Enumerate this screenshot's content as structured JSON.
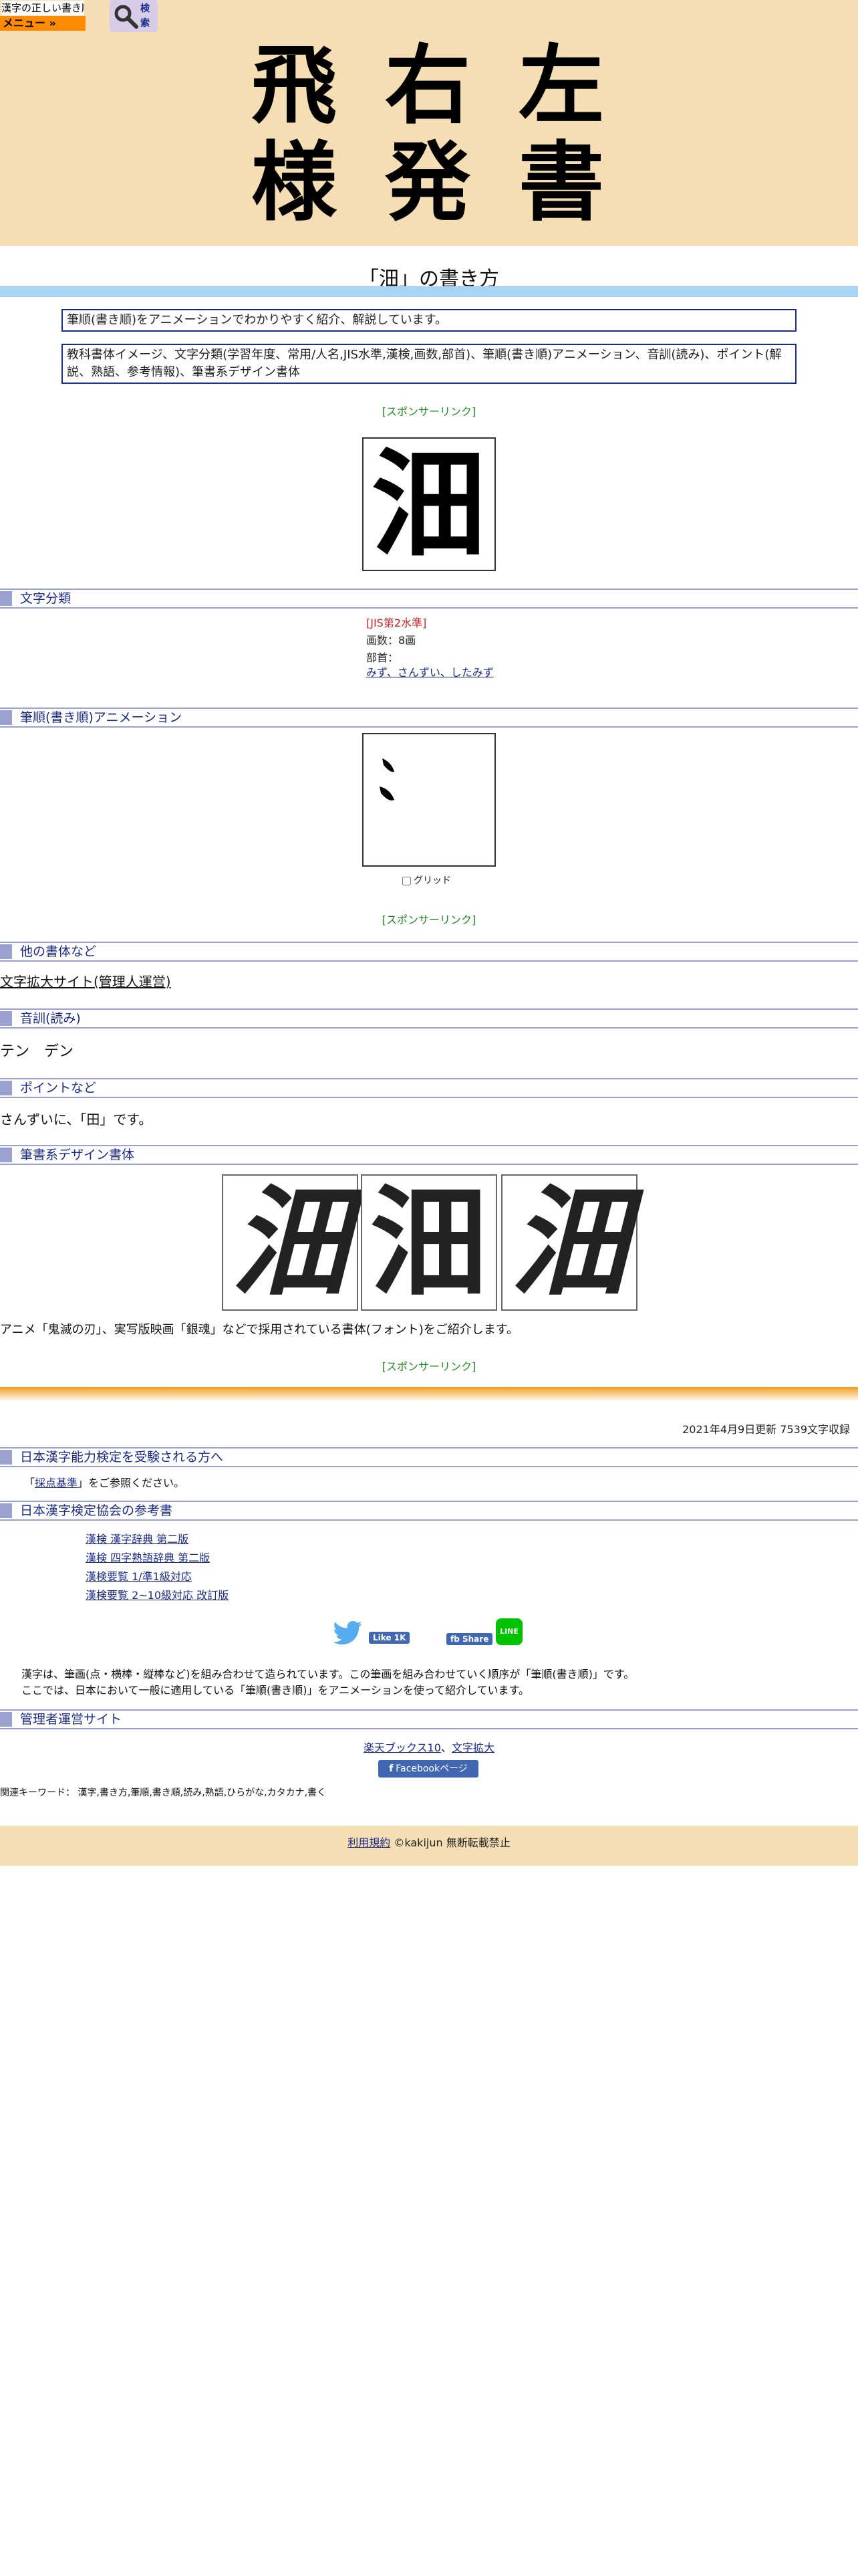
{
  "header": {
    "logo_small": "漢字の正しい書き順(筆順)",
    "menu_label": "メニュー »",
    "search_label": "検索",
    "big_logo_chars": [
      "飛",
      "右",
      "左",
      "様",
      "発",
      "書"
    ]
  },
  "title": "「沺」の書き方",
  "notices": [
    "筆順(書き順)をアニメーションでわかりやすく紹介、解説しています。",
    "教科書体イメージ、文字分類(学習年度、常用/人名,JIS水準,漢検,画数,部首)、筆順(書き順)アニメーション、音訓(読み)、ポイント(解説、熟語、参考情報)、筆書系デザイン書体"
  ],
  "sponsor": "[スポンサーリンク]",
  "kanji": "沺",
  "sections": {
    "classification": "文字分類",
    "animation": "筆順(書き順)アニメーション",
    "other_fonts": "他の書体など",
    "reading": "音訓(読み)",
    "points": "ポイントなど",
    "design": "筆書系デザイン書体",
    "kanken": "日本漢字能力検定を受験される方へ",
    "kanken_refs": "日本漢字検定協会の参考書",
    "admin": "管理者運営サイト"
  },
  "classification": {
    "jis": "[JIS第2水準]",
    "strokes": "画数：8画",
    "radical_label": "部首：",
    "radical_value": "みず、さんずい、したみず"
  },
  "grid_label": "グリッド",
  "other_fonts_link": "文字拡大サイト(管理人運営)",
  "reading_text": "テン　デン",
  "points_text": "さんずいに、「田」です。",
  "design_note": "アニメ「鬼滅の刃」、実写版映画「銀魂」などで採用されている書体(フォント)をご紹介します。",
  "update_text": "2021年4月9日更新 7539文字収録",
  "kanken_text_prefix": "「",
  "kanken_link": "採点基準",
  "kanken_text_suffix": "」をご参照ください。",
  "refs": [
    "漢検 漢字辞典 第二版",
    "漢検 四字熟語辞典 第二版",
    "漢検要覧 1/準1級対応",
    "漢検要覧 2~10級対応 改訂版"
  ],
  "social": {
    "like": "Like 1K",
    "share": "fb Share",
    "line": "LINE"
  },
  "about_lines": [
    "漢字は、筆画(点・横棒・縦棒など)を組み合わせて造られています。この筆画を組み合わせていく順序が「筆順(書き順)」です。",
    "ここでは、日本において一般に適用している「筆順(書き順)」をアニメーションを使って紹介しています。"
  ],
  "admin_links": [
    "楽天ブックス10",
    "文字拡大"
  ],
  "admin_sep": "、",
  "facebook_page": "Facebookページ",
  "keywords": "関連キーワード： 漢字,書き方,筆順,書き順,読み,熟語,ひらがな,カタカナ,書く",
  "footer": {
    "terms": "利用規約",
    "copyright": "©kakijun 無断転載禁止"
  },
  "colors": {
    "header_bg": "#f5deb3",
    "menu_bg": "#ff8c00",
    "title_bar": "#aad4f5",
    "section_accent": "#9aa0d0",
    "link": "#1a2b8c",
    "sponsor": "#228b22"
  }
}
